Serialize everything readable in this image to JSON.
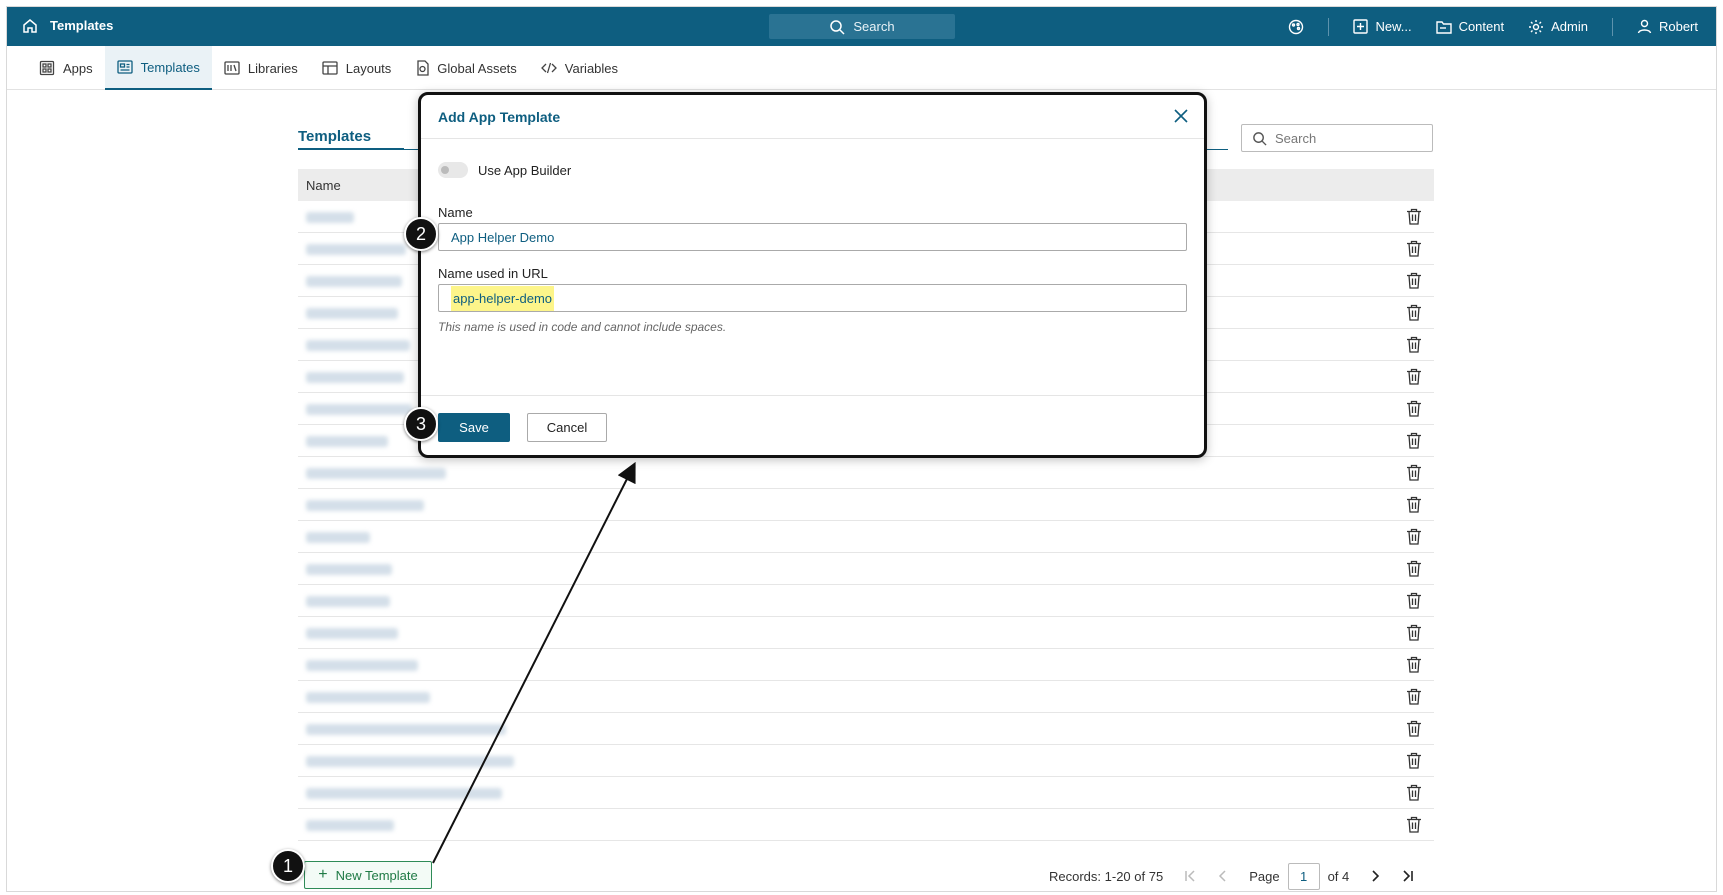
{
  "topbar": {
    "title": "Templates",
    "search_label": "Search",
    "new_label": "New...",
    "content_label": "Content",
    "admin_label": "Admin",
    "user_label": "Robert"
  },
  "tabs": [
    {
      "label": "Apps",
      "icon": "apps-icon"
    },
    {
      "label": "Templates",
      "icon": "templates-icon",
      "active": true
    },
    {
      "label": "Libraries",
      "icon": "libraries-icon"
    },
    {
      "label": "Layouts",
      "icon": "layouts-icon"
    },
    {
      "label": "Global Assets",
      "icon": "global-assets-icon"
    },
    {
      "label": "Variables",
      "icon": "code-icon"
    }
  ],
  "list": {
    "title": "Templates",
    "search_placeholder": "Search",
    "column_name": "Name",
    "row_count": 20,
    "new_button_label": "New Template",
    "records_label": "Records: 1-20 of 75",
    "page_label": "Page",
    "page_value": "1",
    "of_label": "of 4"
  },
  "modal": {
    "title": "Add App Template",
    "toggle_label": "Use App Builder",
    "name_label": "Name",
    "name_value": "App Helper Demo",
    "url_label": "Name used in URL",
    "url_value": "app-helper-demo",
    "hint": "This name is used in code and cannot include spaces.",
    "save_label": "Save",
    "cancel_label": "Cancel"
  },
  "steps": [
    "1",
    "2",
    "3"
  ],
  "colors": {
    "brand": "#0e5e80",
    "highlight": "#fdf58a",
    "new_button": "#2e8b57"
  }
}
